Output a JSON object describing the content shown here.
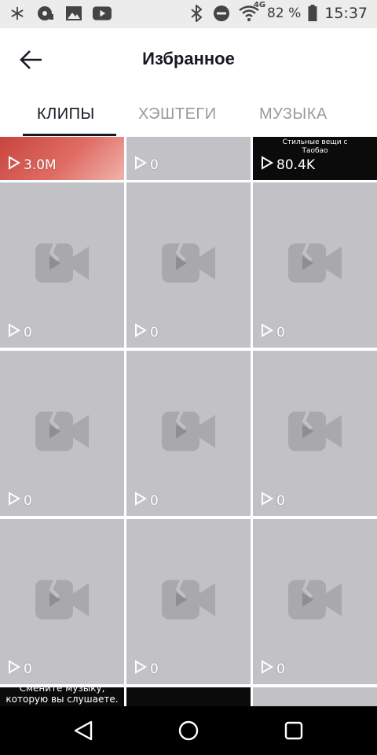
{
  "status_bar": {
    "icons_left": [
      "snowflake-icon",
      "music-disc-icon",
      "image-icon",
      "youtube-icon"
    ],
    "icons_right": [
      "bluetooth-icon",
      "do-not-disturb-icon",
      "wifi-icon",
      "battery-icon"
    ],
    "network": "4G",
    "battery": "82 %",
    "time": "15:37"
  },
  "header": {
    "title": "Избранное"
  },
  "tabs": [
    {
      "label": "КЛИПЫ",
      "active": true
    },
    {
      "label": "ХЭШТЕГИ",
      "active": false
    },
    {
      "label": "МУЗЫКА",
      "active": false
    }
  ],
  "grid": {
    "row1": [
      {
        "views": "3.0M",
        "style": "red"
      },
      {
        "views": "0",
        "style": "placeholder"
      },
      {
        "views": "80.4K",
        "style": "black",
        "caption": "Стильные вещи с Таобао"
      }
    ],
    "row2": [
      {
        "views": "0"
      },
      {
        "views": "0"
      },
      {
        "views": "0"
      }
    ],
    "row3": [
      {
        "views": "0"
      },
      {
        "views": "0"
      },
      {
        "views": "0"
      }
    ],
    "row4": [
      {
        "views": "0"
      },
      {
        "views": "0"
      },
      {
        "views": "0"
      }
    ],
    "row5": [
      {
        "caption": "Смените музыку, которую вы слушаете."
      },
      {
        "style": "black"
      },
      {
        "style": "placeholder"
      }
    ]
  },
  "nav": {
    "icons": [
      "back-triangle-icon",
      "home-circle-icon",
      "recents-square-icon"
    ]
  }
}
